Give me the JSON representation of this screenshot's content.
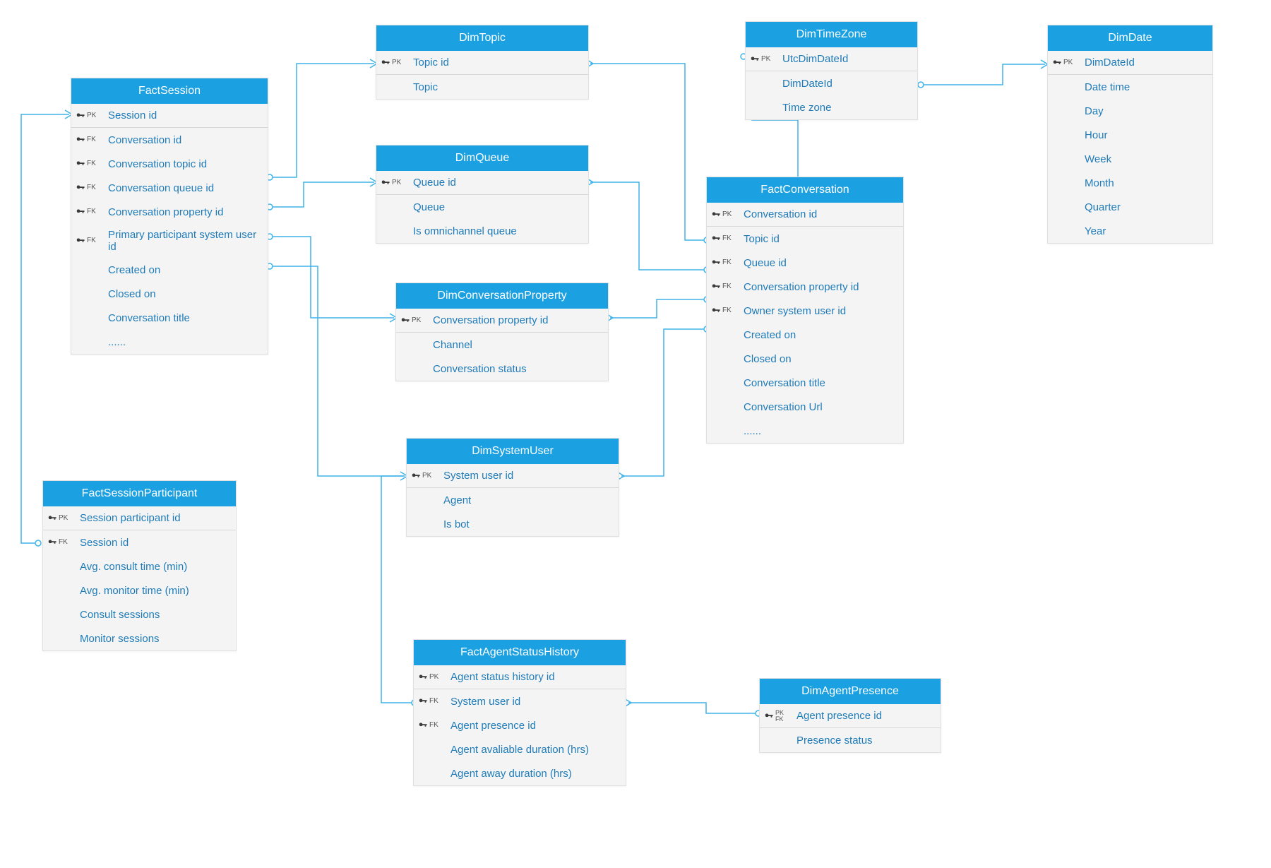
{
  "diagram_type": "entity-relationship",
  "entities": {
    "factSession": {
      "title": "FactSession",
      "fields": [
        {
          "key": "PK",
          "label": "Session id"
        },
        {
          "key": "FK",
          "label": "Conversation id"
        },
        {
          "key": "FK",
          "label": "Conversation topic id"
        },
        {
          "key": "FK",
          "label": "Conversation queue id"
        },
        {
          "key": "FK",
          "label": "Conversation property id"
        },
        {
          "key": "FK",
          "label": "Primary participant system user id"
        },
        {
          "key": "",
          "label": "Created on"
        },
        {
          "key": "",
          "label": "Closed on"
        },
        {
          "key": "",
          "label": "Conversation title"
        },
        {
          "key": "",
          "label": "......"
        }
      ]
    },
    "factSessionParticipant": {
      "title": "FactSessionParticipant",
      "fields": [
        {
          "key": "PK",
          "label": "Session participant id"
        },
        {
          "key": "FK",
          "label": "Session id"
        },
        {
          "key": "",
          "label": "Avg. consult time (min)"
        },
        {
          "key": "",
          "label": "Avg. monitor time (min)"
        },
        {
          "key": "",
          "label": "Consult sessions"
        },
        {
          "key": "",
          "label": "Monitor sessions"
        }
      ]
    },
    "dimTopic": {
      "title": "DimTopic",
      "fields": [
        {
          "key": "PK",
          "label": "Topic id"
        },
        {
          "key": "",
          "label": "Topic"
        }
      ]
    },
    "dimQueue": {
      "title": "DimQueue",
      "fields": [
        {
          "key": "PK",
          "label": "Queue id"
        },
        {
          "key": "",
          "label": "Queue"
        },
        {
          "key": "",
          "label": "Is omnichannel queue"
        }
      ]
    },
    "dimConversationProperty": {
      "title": "DimConversationProperty",
      "fields": [
        {
          "key": "PK",
          "label": "Conversation property id"
        },
        {
          "key": "",
          "label": "Channel"
        },
        {
          "key": "",
          "label": "Conversation status"
        }
      ]
    },
    "dimSystemUser": {
      "title": "DimSystemUser",
      "fields": [
        {
          "key": "PK",
          "label": "System user id"
        },
        {
          "key": "",
          "label": "Agent"
        },
        {
          "key": "",
          "label": "Is bot"
        }
      ]
    },
    "factAgentStatusHistory": {
      "title": "FactAgentStatusHistory",
      "fields": [
        {
          "key": "PK",
          "label": "Agent status history id"
        },
        {
          "key": "FK",
          "label": "System user id"
        },
        {
          "key": "FK",
          "label": "Agent presence id"
        },
        {
          "key": "",
          "label": "Agent avaliable duration (hrs)"
        },
        {
          "key": "",
          "label": "Agent away duration (hrs)"
        }
      ]
    },
    "dimTimeZone": {
      "title": "DimTimeZone",
      "fields": [
        {
          "key": "PK",
          "label": "UtcDimDateId"
        },
        {
          "key": "",
          "label": "DimDateId"
        },
        {
          "key": "",
          "label": "Time zone"
        }
      ]
    },
    "factConversation": {
      "title": "FactConversation",
      "fields": [
        {
          "key": "PK",
          "label": "Conversation id"
        },
        {
          "key": "FK",
          "label": "Topic id"
        },
        {
          "key": "FK",
          "label": "Queue id"
        },
        {
          "key": "FK",
          "label": "Conversation property id"
        },
        {
          "key": "FK",
          "label": "Owner system user id"
        },
        {
          "key": "",
          "label": "Created on"
        },
        {
          "key": "",
          "label": "Closed on"
        },
        {
          "key": "",
          "label": "Conversation title"
        },
        {
          "key": "",
          "label": "Conversation Url"
        },
        {
          "key": "",
          "label": "......"
        }
      ]
    },
    "dimAgentPresence": {
      "title": "DimAgentPresence",
      "fields": [
        {
          "key": "PKFK",
          "label": "Agent presence id"
        },
        {
          "key": "",
          "label": "Presence status"
        }
      ]
    },
    "dimDate": {
      "title": "DimDate",
      "fields": [
        {
          "key": "PK",
          "label": "DimDateId"
        },
        {
          "key": "",
          "label": "Date time"
        },
        {
          "key": "",
          "label": "Day"
        },
        {
          "key": "",
          "label": "Hour"
        },
        {
          "key": "",
          "label": "Week"
        },
        {
          "key": "",
          "label": "Month"
        },
        {
          "key": "",
          "label": "Quarter"
        },
        {
          "key": "",
          "label": "Year"
        }
      ]
    }
  }
}
